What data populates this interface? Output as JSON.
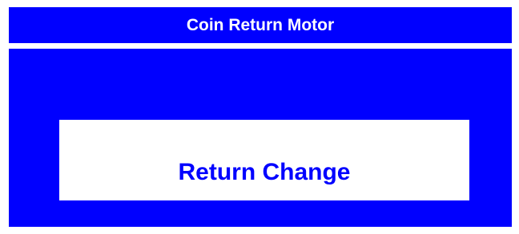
{
  "header": {
    "title": "Coin Return Motor"
  },
  "main": {
    "return_button_label": "Return Change"
  },
  "colors": {
    "panel_blue": "#0000ff",
    "button_white": "#ffffff",
    "text_white": "#ffffff",
    "text_blue": "#0000ff"
  }
}
